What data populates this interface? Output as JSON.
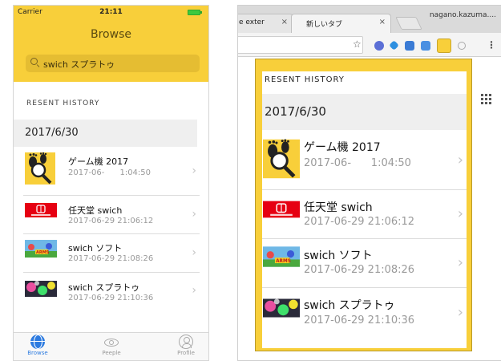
{
  "phone": {
    "status": {
      "carrier": "Carrier",
      "time": "21:11"
    },
    "title": "Browse",
    "search": {
      "value": "swich スプラトゥ"
    },
    "recent_label": "RESENT HISTORY",
    "date_header": "2017/6/30",
    "items": [
      {
        "title": "ゲーム機 2017",
        "time": "2017-06-      1:04:50"
      },
      {
        "title": "任天堂 swich",
        "time": "2017-06-29 21:06:12"
      },
      {
        "title": "swich ソフト",
        "time": "2017-06-29 21:08:26"
      },
      {
        "title": "swich スプラトゥ",
        "time": "2017-06-29 21:10:36"
      }
    ],
    "tabs": [
      {
        "label": "Browse",
        "color": "#2d7be0"
      },
      {
        "label": "Peeple",
        "color": "#999999"
      },
      {
        "label": "Profile",
        "color": "#999999"
      }
    ]
  },
  "browser": {
    "tabs": [
      {
        "label": "e exter"
      },
      {
        "label": "新しいタブ"
      }
    ],
    "profile": "nagano.kazuma....",
    "popup": {
      "recent_label": "RESENT HISTORY",
      "date_header": "2017/6/30",
      "items": [
        {
          "title": "ゲーム機 2017",
          "time": "2017-06-      1:04:50"
        },
        {
          "title": "任天堂 swich",
          "time": "2017-06-29 21:06:12"
        },
        {
          "title": "swich ソフト",
          "time": "2017-06-29 21:08:26"
        },
        {
          "title": "swich スプラトゥ",
          "time": "2017-06-29 21:10:36"
        }
      ]
    }
  },
  "colors": {
    "accent": "#f8cf3a",
    "tab_active": "#2d7be0",
    "switch_red": "#e60012"
  }
}
